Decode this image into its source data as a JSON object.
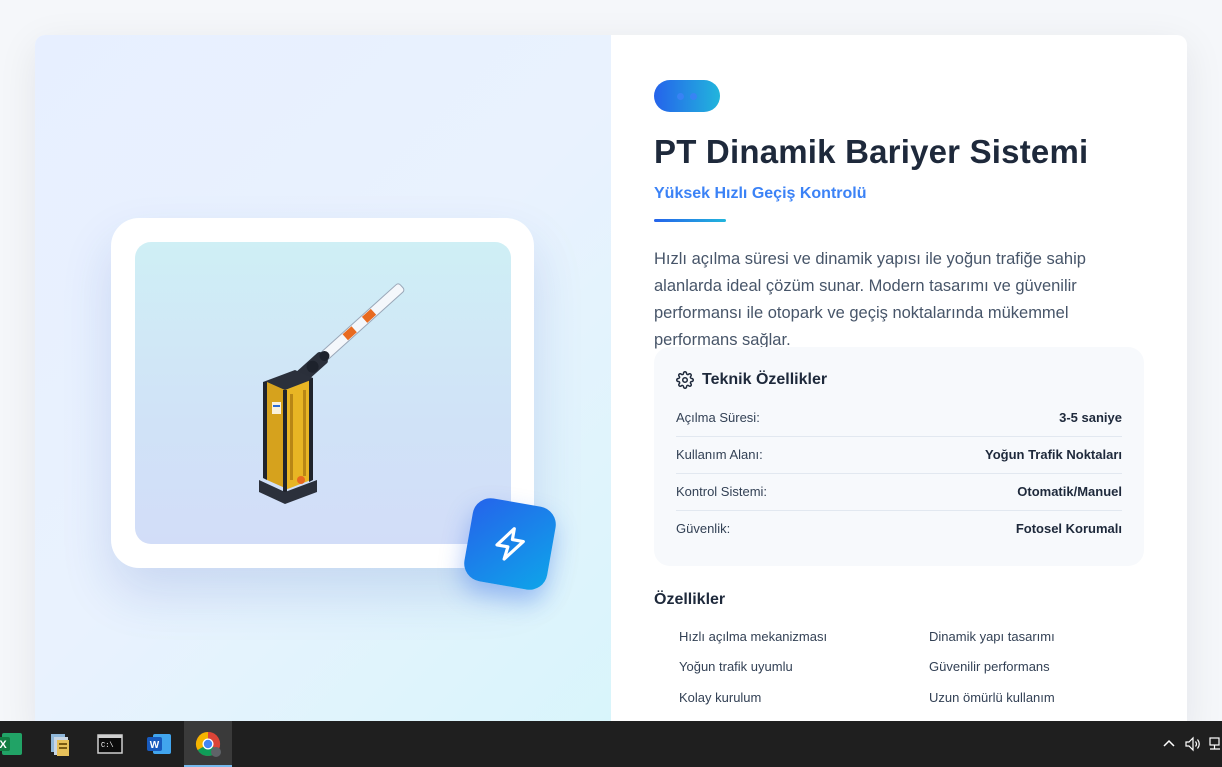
{
  "product": {
    "title": "PT Dinamik Bariyer Sistemi",
    "subtitle": "Yüksek Hızlı Geçiş Kontrolü",
    "description": "Hızlı açılma süresi ve dinamik yapısı ile yoğun trafiğe sahip alanlarda ideal çözüm sunar. Modern tasarımı ve güvenilir performansı ile otopark ve geçiş noktalarında mükemmel performans sağlar.",
    "image_icon": "lightning-bolt-icon"
  },
  "specs": {
    "heading": "Teknik Özellikler",
    "heading_icon": "gear-icon",
    "rows": [
      {
        "label": "Açılma Süresi:",
        "value": "3-5 saniye"
      },
      {
        "label": "Kullanım Alanı:",
        "value": "Yoğun Trafik Noktaları"
      },
      {
        "label": "Kontrol Sistemi:",
        "value": "Otomatik/Manuel"
      },
      {
        "label": "Güvenlik:",
        "value": "Fotosel Korumalı"
      }
    ]
  },
  "features": {
    "heading": "Özellikler",
    "items": [
      "Hızlı açılma mekanizması",
      "Dinamik yapı tasarımı",
      "Yoğun trafik uyumlu",
      "Güvenilir performans",
      "Kolay kurulum",
      "Uzun ömürlü kullanım"
    ]
  },
  "colors": {
    "accent": "#2563eb",
    "accent_light": "#3b82f6",
    "gradient_end": "#22b5dc",
    "text_dark": "#1e293b"
  },
  "taskbar": {
    "apps": [
      "excel-icon",
      "file-explorer-icon",
      "command-prompt-icon",
      "word-icon",
      "chrome-icon"
    ],
    "active_app": "chrome-icon",
    "tray_icons": [
      "chevron-up-icon",
      "volume-icon",
      "network-icon"
    ]
  }
}
